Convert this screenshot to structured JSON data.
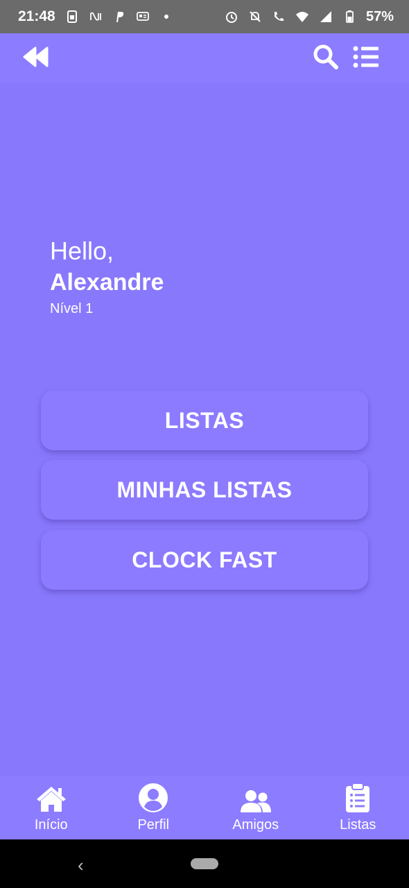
{
  "status_bar": {
    "time": "21:48",
    "battery": "57%",
    "icons": [
      "sim-icon",
      "nubank-icon",
      "paypal-icon",
      "chat-icon",
      "dot-icon",
      "alarm-icon",
      "mute-icon",
      "call-4g-icon",
      "wifi-icon",
      "signal-icon",
      "battery-icon"
    ]
  },
  "app_bar": {
    "left_icon": "rewind-icon",
    "right_icons": [
      "search-icon",
      "list-icon"
    ]
  },
  "greeting": {
    "hello": "Hello,",
    "name": "Alexandre",
    "level": "Nível 1"
  },
  "menu": {
    "items": [
      {
        "label": "LISTAS"
      },
      {
        "label": "MINHAS LISTAS"
      },
      {
        "label": "CLOCK FAST"
      }
    ]
  },
  "bottom_nav": {
    "items": [
      {
        "label": "Início",
        "icon": "home-icon"
      },
      {
        "label": "Perfil",
        "icon": "profile-icon"
      },
      {
        "label": "Amigos",
        "icon": "friends-icon"
      },
      {
        "label": "Listas",
        "icon": "clipboard-icon"
      }
    ]
  },
  "colors": {
    "background": "#8878fc",
    "bar": "#8c7cff",
    "status_bar": "#6b6b6b"
  }
}
